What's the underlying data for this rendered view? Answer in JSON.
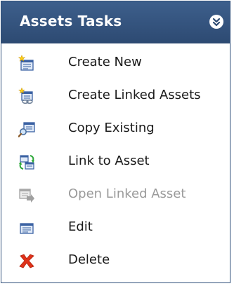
{
  "panel": {
    "title": "Assets Tasks",
    "collapse_icon": "double-chevron-up-icon"
  },
  "items": [
    {
      "label": "Create New",
      "icon": "create-new-icon",
      "enabled": true
    },
    {
      "label": "Create Linked Assets",
      "icon": "create-linked-assets-icon",
      "enabled": true
    },
    {
      "label": "Copy Existing",
      "icon": "copy-existing-icon",
      "enabled": true
    },
    {
      "label": "Link to Asset",
      "icon": "link-to-asset-icon",
      "enabled": true
    },
    {
      "label": "Open Linked Asset",
      "icon": "open-linked-asset-icon",
      "enabled": false
    },
    {
      "label": "Edit",
      "icon": "edit-icon",
      "enabled": true
    },
    {
      "label": "Delete",
      "icon": "delete-icon",
      "enabled": true
    }
  ],
  "colors": {
    "header_bg": "#2d4a72",
    "header_text": "#ffffff",
    "label_text": "#1a1a1a",
    "disabled_text": "#9a9a9a",
    "delete_red": "#e0321a"
  }
}
